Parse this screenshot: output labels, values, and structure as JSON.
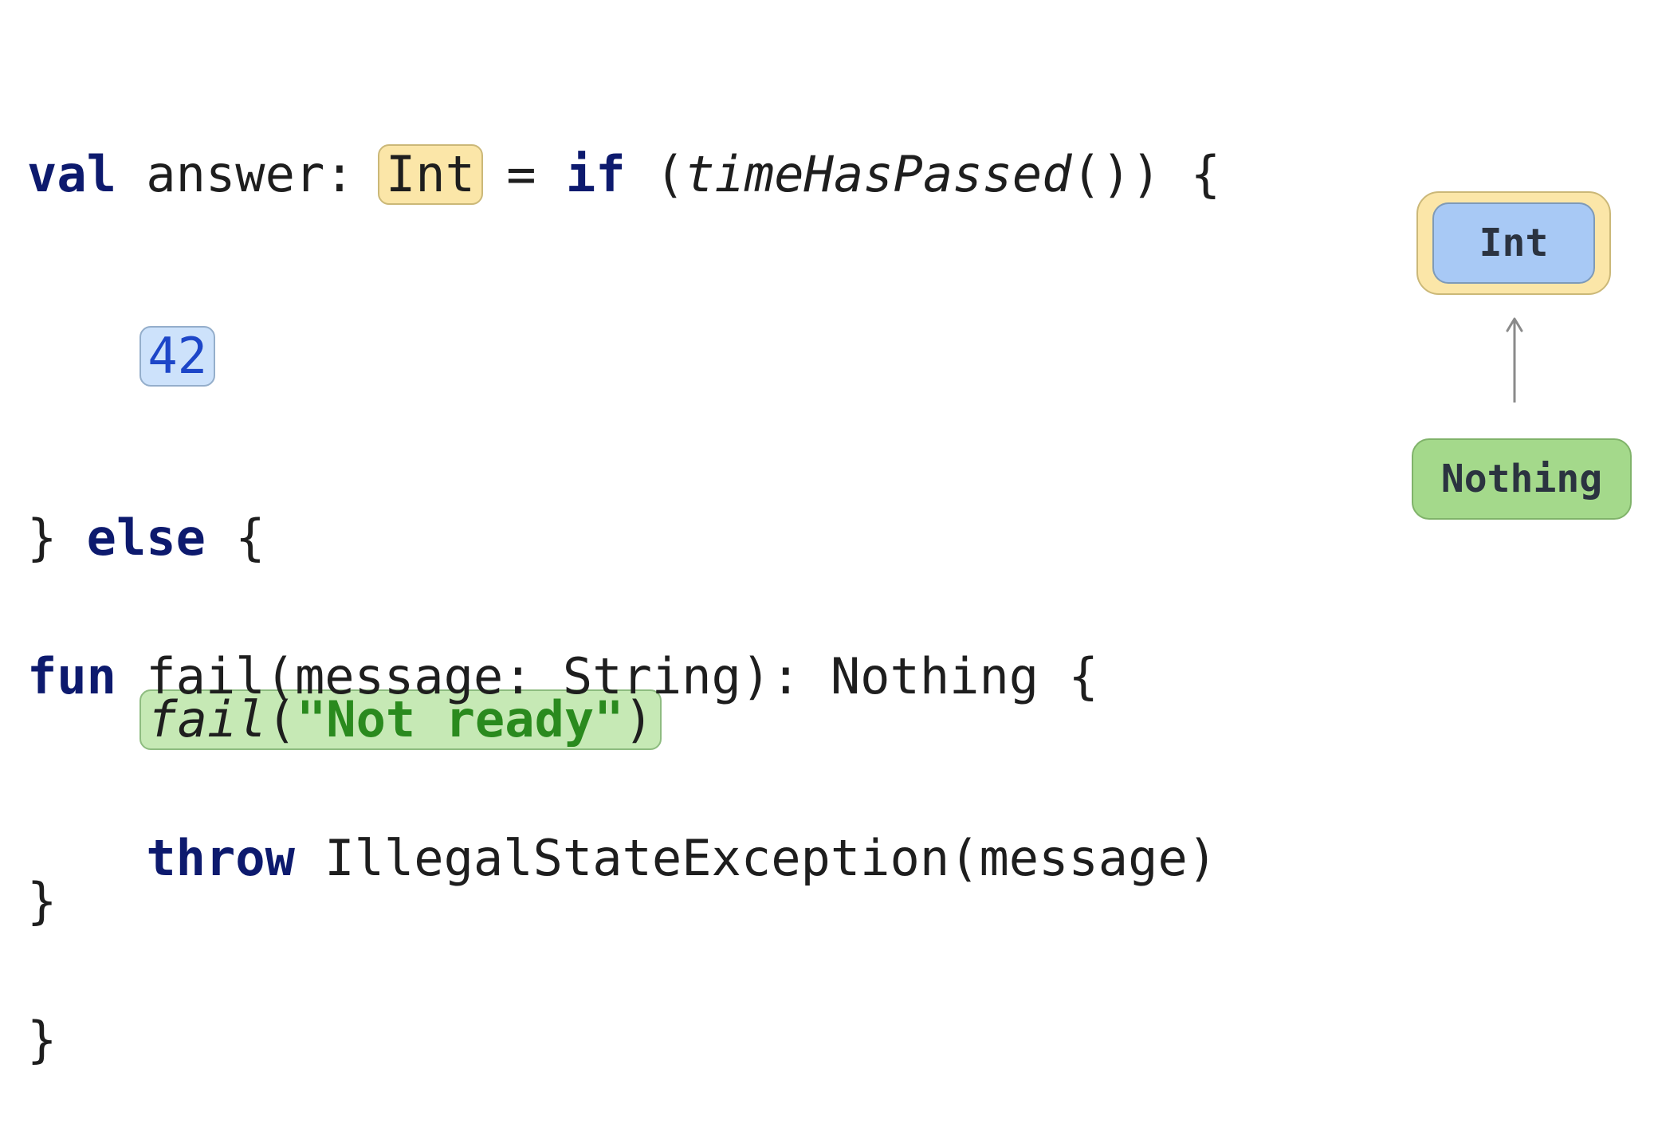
{
  "code_top": {
    "line1": {
      "kw_val": "val",
      "name": " answer: ",
      "type": "Int",
      "eq": " = ",
      "kw_if": "if",
      "open": " (",
      "call": "timeHasPassed",
      "close": "()) {"
    },
    "line2": {
      "indent": "    ",
      "value": "42"
    },
    "line3": {
      "brace": "} ",
      "kw_else": "else",
      "rest": " {"
    },
    "line4": {
      "indent": "    ",
      "fn": "fail",
      "paren_open": "(",
      "arg": "\"Not ready\"",
      "paren_close": ")"
    },
    "line5": {
      "brace": "}"
    }
  },
  "code_bottom": {
    "line1": {
      "kw_fun": "fun",
      "rest": " fail(message: String): Nothing {"
    },
    "line2": {
      "indent": "    ",
      "kw_throw": "throw",
      "rest": " IllegalStateException(message)"
    },
    "line3": {
      "brace": "}"
    }
  },
  "type_hierarchy": {
    "upper_outer_color": "#fbe6a8",
    "upper_inner_color": "#a8c9f5",
    "upper_label": "Int",
    "lower_label": "Nothing",
    "lower_color": "#a4d98b",
    "arrow_icon": "up-arrow-icon"
  }
}
